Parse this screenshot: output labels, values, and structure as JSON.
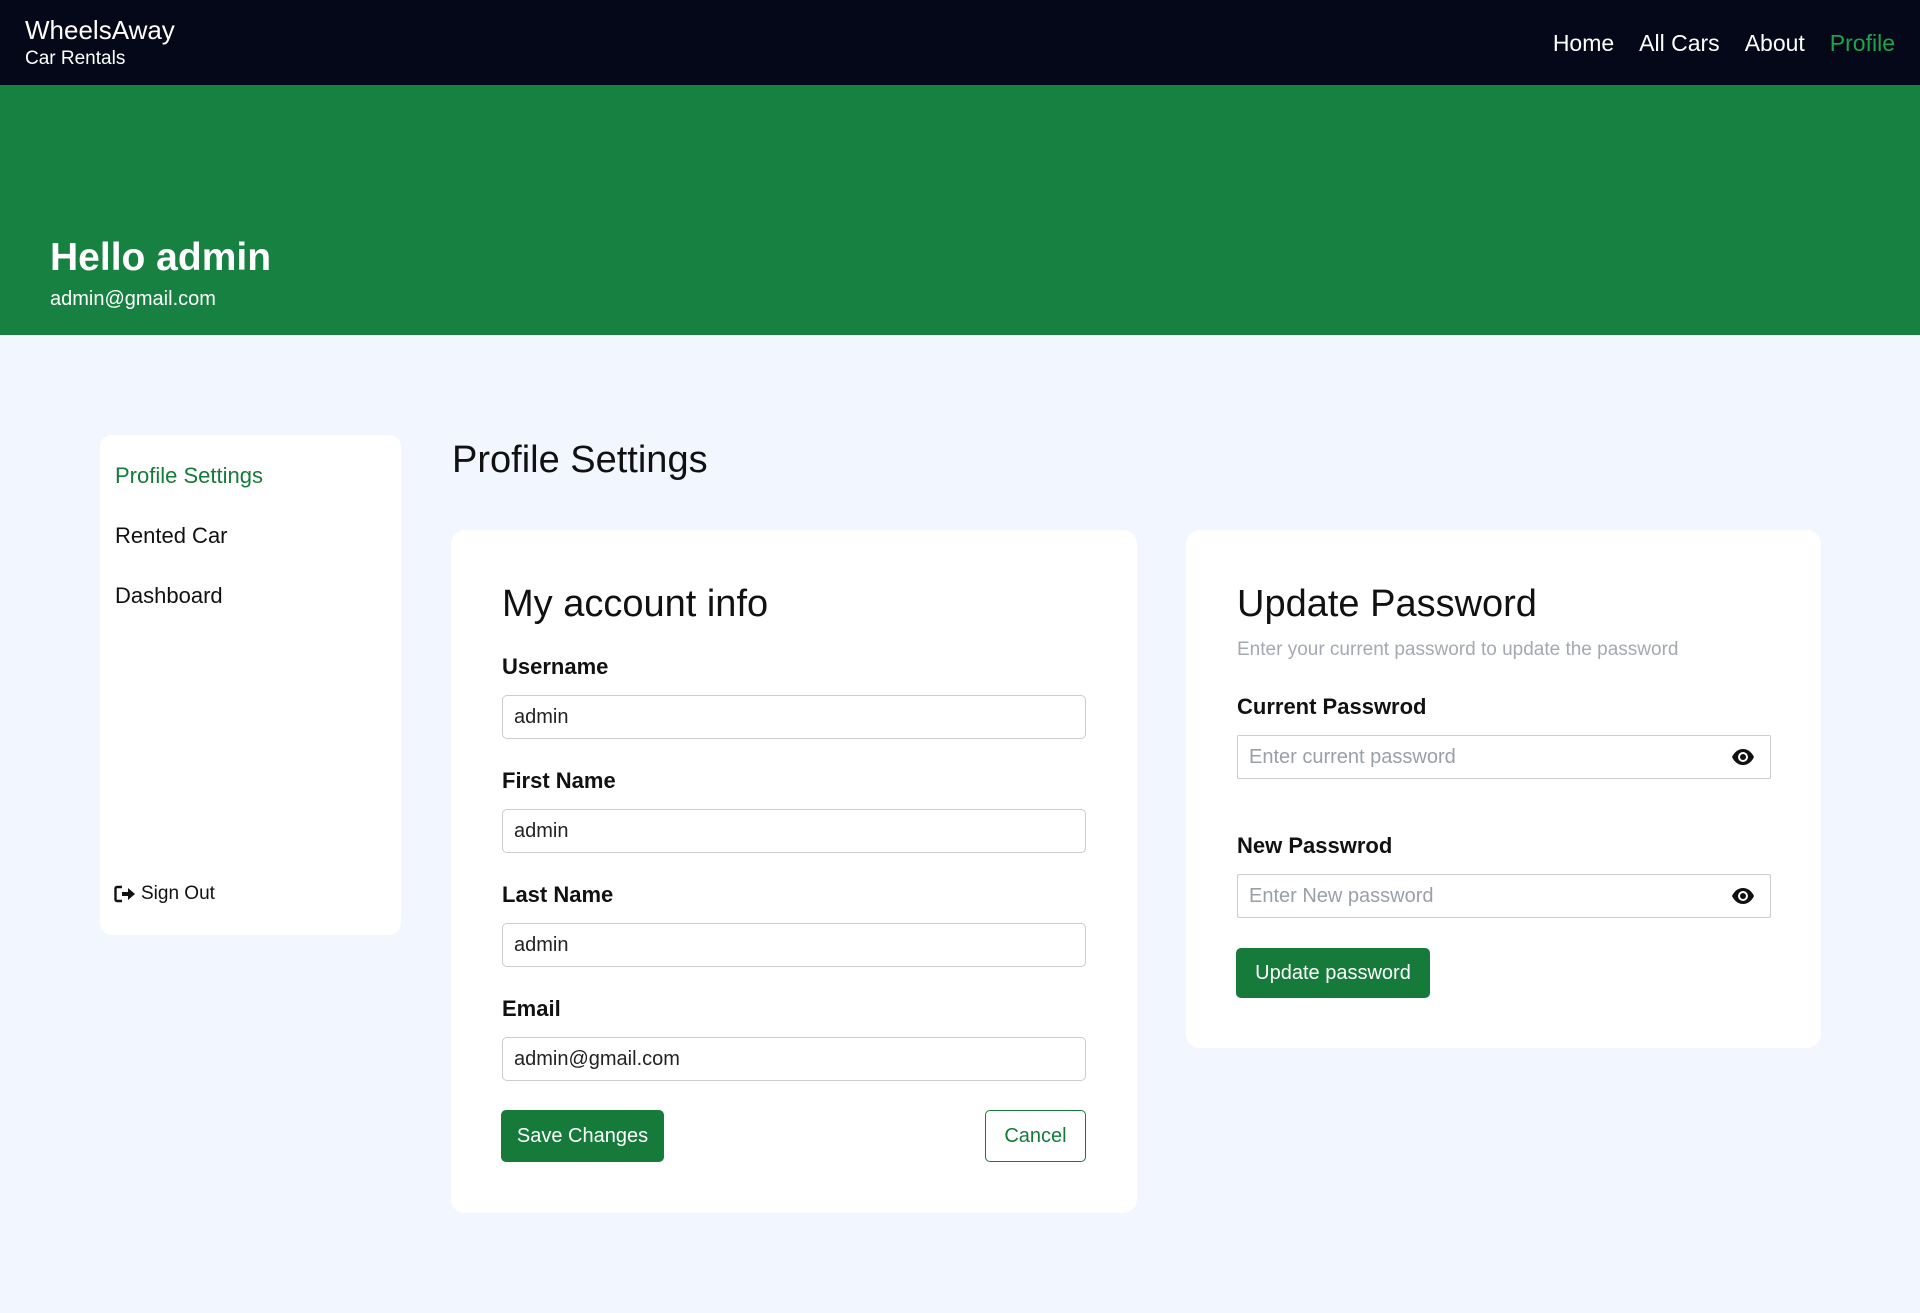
{
  "nav": {
    "brand_name": "WheelsAway",
    "brand_sub": "Car Rentals",
    "links": [
      {
        "label": "Home"
      },
      {
        "label": "All Cars"
      },
      {
        "label": "About"
      },
      {
        "label": "Profile",
        "active": true
      }
    ]
  },
  "hero": {
    "greeting": "Hello admin",
    "email": "admin@gmail.com"
  },
  "sidebar": {
    "items": [
      {
        "label": "Profile Settings",
        "active": true
      },
      {
        "label": "Rented Car"
      },
      {
        "label": "Dashboard"
      }
    ],
    "signout_label": "Sign Out",
    "signout_icon": "sign-out-icon"
  },
  "main": {
    "heading": "Profile Settings"
  },
  "account": {
    "title": "My account info",
    "fields": [
      {
        "label": "Username",
        "value": "admin"
      },
      {
        "label": "First Name",
        "value": "admin"
      },
      {
        "label": "Last Name",
        "value": "admin"
      },
      {
        "label": "Email",
        "value": "admin@gmail.com"
      }
    ],
    "save_label": "Save Changes",
    "cancel_label": "Cancel"
  },
  "password": {
    "title": "Update Password",
    "subtitle": "Enter your current password to update the password",
    "current_label": "Current Passwrod",
    "current_placeholder": "Enter current password",
    "new_label": "New Passwrod",
    "new_placeholder": "Enter New password",
    "eye_icon": "eye-icon",
    "submit_label": "Update password"
  },
  "colors": {
    "nav_bg": "#040818",
    "accent_green": "#168140",
    "button_green": "#167a3b",
    "active_link": "#1fa34a",
    "page_bg": "#f2f6fe"
  }
}
